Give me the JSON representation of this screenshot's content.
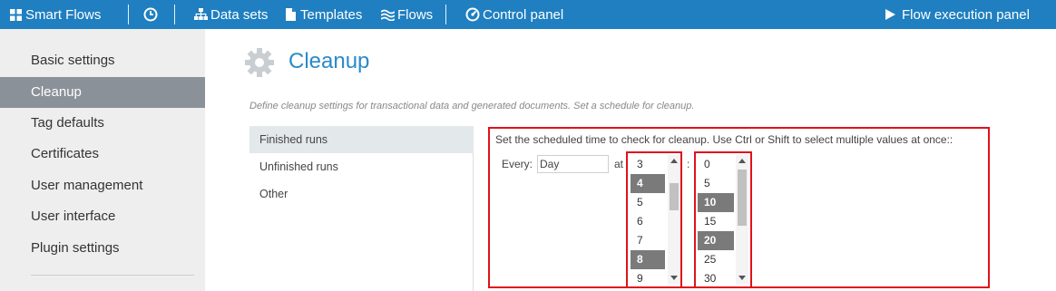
{
  "topbar": {
    "brand": "Smart Flows",
    "history_icon": "clock-icon",
    "datasets": "Data sets",
    "templates": "Templates",
    "flows": "Flows",
    "control_panel": "Control panel",
    "flow_exec": "Flow execution panel"
  },
  "sidebar": {
    "items": [
      {
        "label": "Basic settings",
        "active": false
      },
      {
        "label": "Cleanup",
        "active": true
      },
      {
        "label": "Tag defaults",
        "active": false
      },
      {
        "label": "Certificates",
        "active": false
      },
      {
        "label": "User management",
        "active": false
      },
      {
        "label": "User interface",
        "active": false
      },
      {
        "label": "Plugin settings",
        "active": false
      }
    ]
  },
  "page": {
    "title": "Cleanup",
    "description": "Define cleanup settings for transactional data and generated documents. Set a schedule for cleanup."
  },
  "runs": {
    "tabs": [
      {
        "label": "Finished runs",
        "active": true
      },
      {
        "label": "Unfinished runs",
        "active": false
      },
      {
        "label": "Other",
        "active": false
      }
    ]
  },
  "schedule": {
    "instructions": "Set the scheduled time to check for cleanup. Use Ctrl or Shift to select multiple values at once::",
    "every_label": "Every:",
    "every_value": "Day",
    "at_label": "at",
    "colon": ":",
    "hours": [
      {
        "label": "3",
        "selected": false
      },
      {
        "label": "4",
        "selected": true
      },
      {
        "label": "5",
        "selected": false
      },
      {
        "label": "6",
        "selected": false
      },
      {
        "label": "7",
        "selected": false
      },
      {
        "label": "8",
        "selected": true
      },
      {
        "label": "9",
        "selected": false
      }
    ],
    "minutes": [
      {
        "label": "0",
        "selected": false
      },
      {
        "label": "5",
        "selected": false
      },
      {
        "label": "10",
        "selected": true
      },
      {
        "label": "15",
        "selected": false
      },
      {
        "label": "20",
        "selected": true
      },
      {
        "label": "25",
        "selected": false
      },
      {
        "label": "30",
        "selected": false
      }
    ]
  },
  "colors": {
    "topbar": "#1f7fc0",
    "accent": "#2a8ac8",
    "highlight_border": "#e0121a",
    "selected_option": "#7a7a7a",
    "sidebar_active": "#8a9198"
  }
}
